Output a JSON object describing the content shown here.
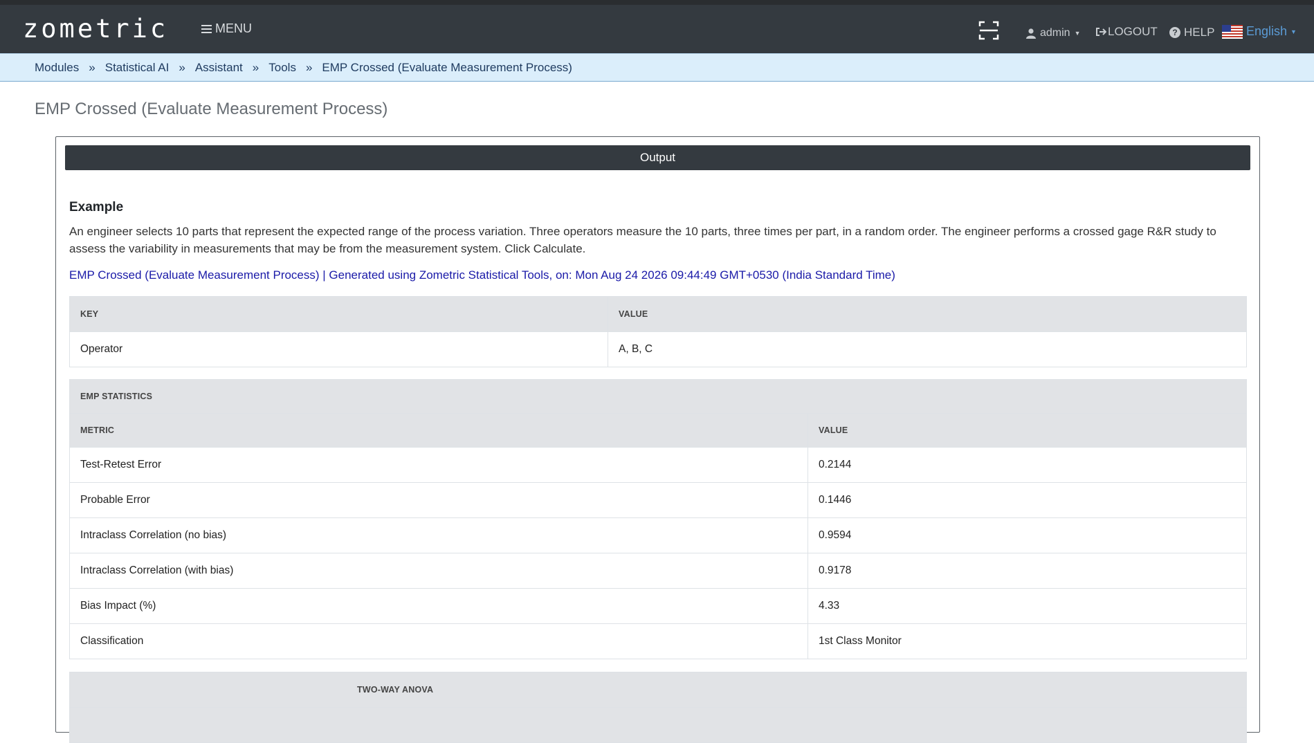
{
  "app": {
    "logo": "zometric",
    "menu_label": "MENU",
    "user_label": "admin",
    "logout_label": "LOGOUT",
    "help_label": "HELP",
    "language_label": "English"
  },
  "breadcrumb": [
    "Modules",
    "Statistical AI",
    "Assistant",
    "Tools",
    "EMP Crossed (Evaluate Measurement Process)"
  ],
  "page_title": "EMP Crossed (Evaluate Measurement Process)",
  "output": {
    "header": "Output",
    "example_heading": "Example",
    "description": "An engineer selects 10 parts that represent the expected range of the process variation. Three operators measure the 10 parts, three times per part, in a random order. The engineer performs a crossed gage R&R study to assess the variability in measurements that may be from the measurement system. Click Calculate.",
    "generated_line": "EMP Crossed (Evaluate Measurement Process) | Generated using Zometric Statistical Tools, on: Mon Aug 24 2026 09:44:49 GMT+0530 (India Standard Time)"
  },
  "kv_table": {
    "headers": [
      "KEY",
      "VALUE"
    ],
    "rows": [
      [
        "Operator",
        "A, B, C"
      ]
    ]
  },
  "stats_table": {
    "title": "EMP STATISTICS",
    "headers": [
      "METRIC",
      "VALUE"
    ],
    "rows": [
      [
        "Test-Retest Error",
        "0.2144"
      ],
      [
        "Probable Error",
        "0.1446"
      ],
      [
        "Intraclass Correlation (no bias)",
        "0.9594"
      ],
      [
        "Intraclass Correlation (with bias)",
        "0.9178"
      ],
      [
        "Bias Impact (%)",
        "4.33"
      ],
      [
        "Classification",
        "1st Class Monitor"
      ]
    ]
  },
  "anova_table": {
    "title": "TWO-WAY ANOVA"
  }
}
